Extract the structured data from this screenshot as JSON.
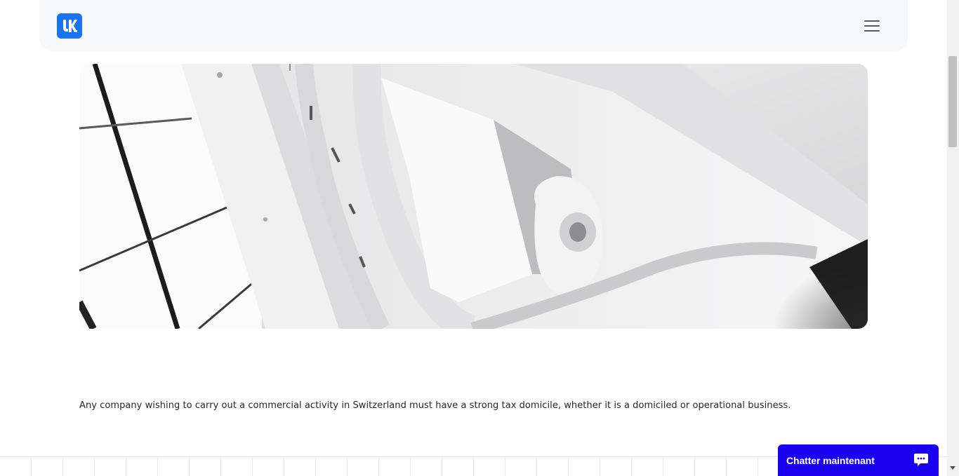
{
  "header": {
    "logo_text": "UK",
    "logo_icon": "uk-logo",
    "menu_icon": "hamburger-menu-icon"
  },
  "hero": {
    "image": "architecture-staircase-photo"
  },
  "content": {
    "intro_text": "Any company wishing to carry out a commercial activity in Switzerland must have a strong tax domicile, whether it is a domiciled or operational business."
  },
  "chat": {
    "label": "Chatter maintenant",
    "icon": "chat-bubble-icon"
  },
  "colors": {
    "logo_bg": "#1a73f0",
    "chat_bg": "#1a00f0",
    "header_bg": "#f7f8fa",
    "text": "#24262b"
  }
}
